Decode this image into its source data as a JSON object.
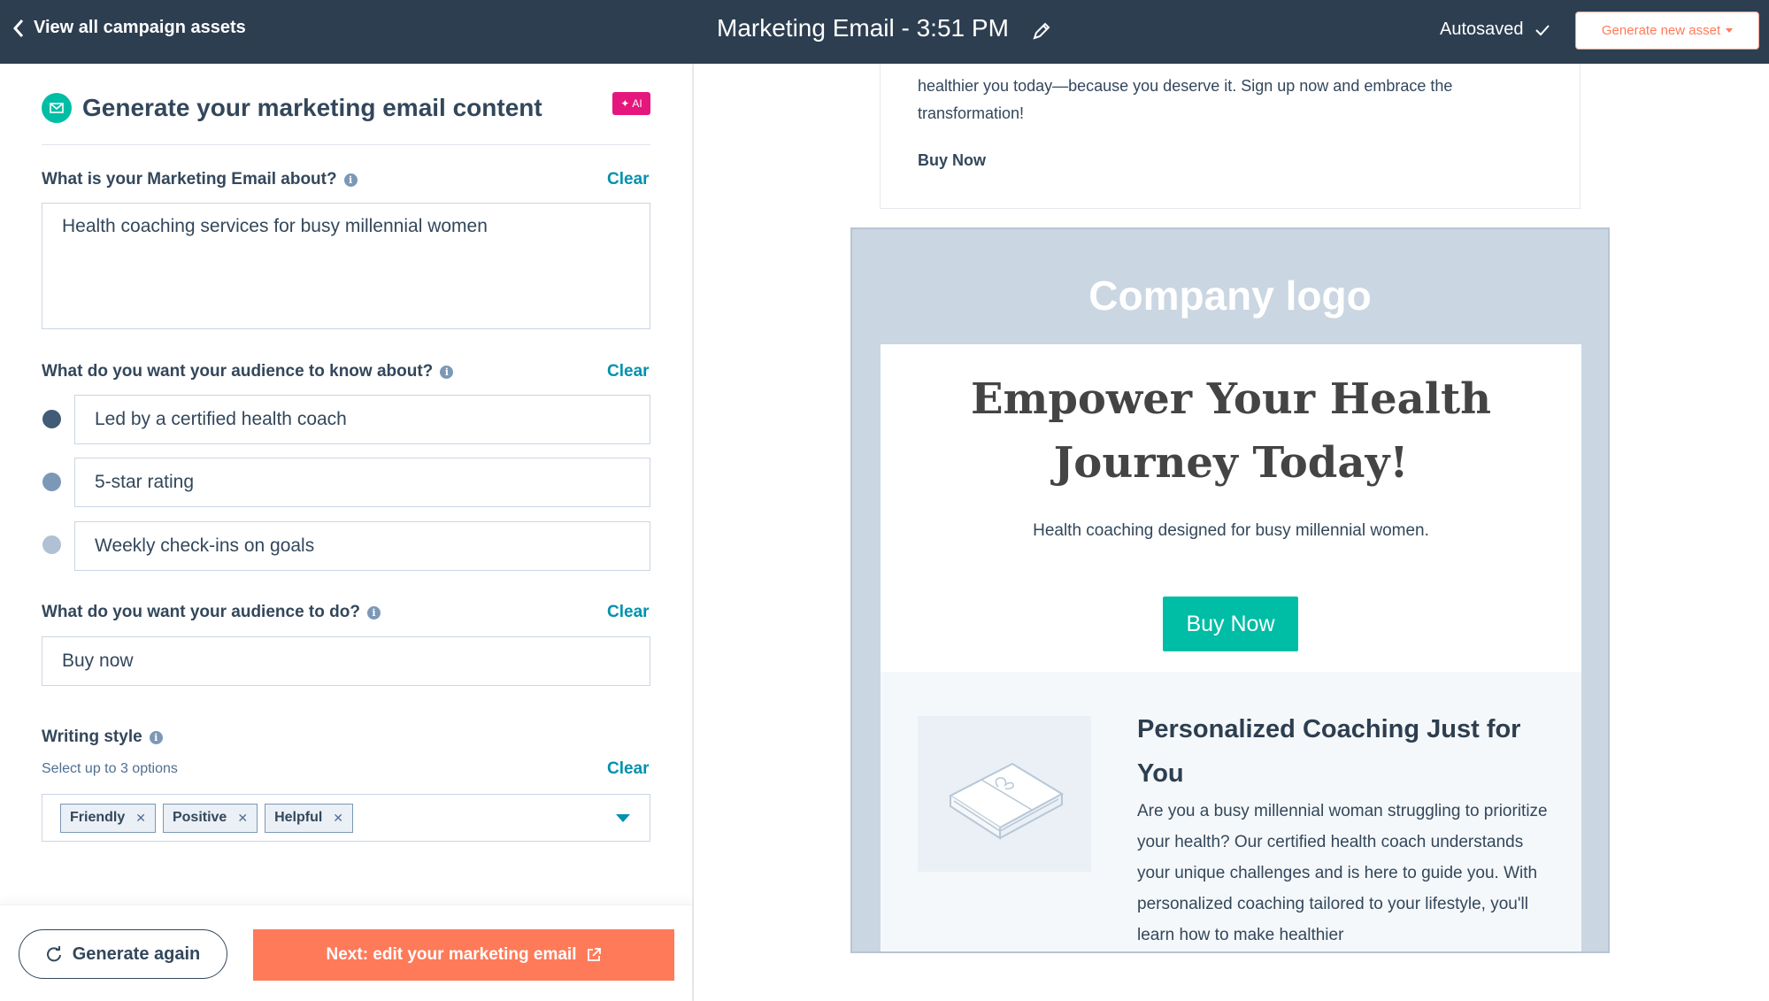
{
  "topbar": {
    "back_label": "View all campaign assets",
    "title": "Marketing Email - 3:51 PM",
    "autosaved": "Autosaved",
    "generate_new_asset": "Generate new asset"
  },
  "panel": {
    "title": "Generate your marketing email content",
    "ai_badge": "AI",
    "about": {
      "label": "What is your Marketing Email about?",
      "clear": "Clear",
      "value": "Health coaching services for busy millennial women"
    },
    "know": {
      "label": "What do you want your audience to know about?",
      "clear": "Clear",
      "points": [
        "Led by a certified health coach",
        "5-star rating",
        "Weekly check-ins on goals"
      ]
    },
    "do": {
      "label": "What do you want your audience to do?",
      "clear": "Clear",
      "value": "Buy now"
    },
    "style": {
      "label": "Writing style",
      "sublabel": "Select up to 3 options",
      "clear": "Clear",
      "tags": [
        "Friendly",
        "Positive",
        "Helpful"
      ]
    },
    "generate_again": "Generate again",
    "next": "Next: edit your marketing email"
  },
  "preview": {
    "prev_text": "healthier you today—because you deserve it. Sign up now and embrace the transformation!",
    "prev_buy": "Buy Now",
    "logo": "Company logo",
    "headline_line1": "Empower Your Health",
    "headline_line2": "Journey Today!",
    "subhead": "Health coaching designed for busy millennial women.",
    "button": "Buy Now",
    "section_title": "Personalized Coaching Just for You",
    "section_text": "Are you a busy millennial woman struggling to prioritize your health? Our certified health coach understands your unique challenges and is here to guide you. With personalized coaching tailored to your lifestyle, you'll learn how to make healthier"
  },
  "colors": {
    "topbar": "#2d3e50",
    "accent_orange": "#ff7a59",
    "link_teal": "#0091ae",
    "button_teal": "#00bda5",
    "ai_pink": "#e5177c"
  }
}
